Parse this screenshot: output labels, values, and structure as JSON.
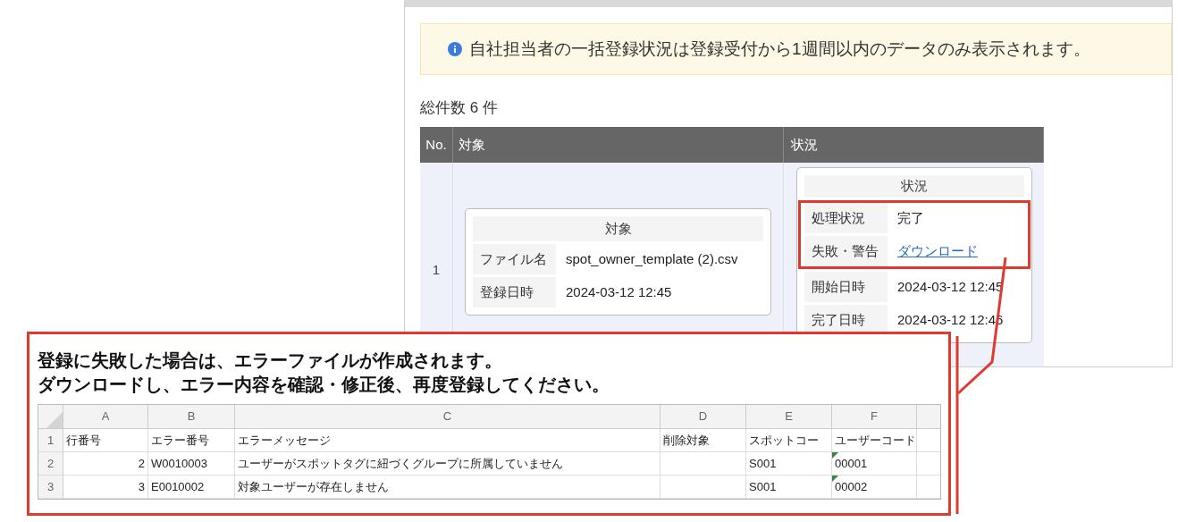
{
  "notice": {
    "text": "自社担当者の一括登録状況は登録受付から1週間以内のデータのみ表示されます。"
  },
  "total_count": "総件数 6 件",
  "table": {
    "columns": [
      "No.",
      "対象",
      "状況"
    ],
    "rows": [
      {
        "no": "1",
        "target": {
          "title": "対象",
          "fields": [
            {
              "label": "ファイル名",
              "value": "spot_owner_template (2).csv",
              "kind": "text"
            },
            {
              "label": "登録日時",
              "value": "2024-03-12 12:45",
              "kind": "text"
            }
          ]
        },
        "status": {
          "title": "状況",
          "fields": [
            {
              "label": "処理状況",
              "value": "完了",
              "kind": "text",
              "highlighted": true
            },
            {
              "label": "失敗・警告",
              "value": "ダウンロード",
              "kind": "link",
              "highlighted": true
            },
            {
              "label": "開始日時",
              "value": "2024-03-12 12:45",
              "kind": "text",
              "highlighted": false
            },
            {
              "label": "完了日時",
              "value": "2024-03-12 12:46",
              "kind": "text",
              "highlighted": false
            }
          ]
        }
      }
    ]
  },
  "callout": {
    "lines": [
      "登録に失敗した場合は、エラーファイルが作成されます。",
      "ダウンロードし、エラー内容を確認・修正後、再度登録してください。"
    ]
  },
  "spreadsheet": {
    "column_letters": [
      "A",
      "B",
      "C",
      "D",
      "E",
      "F"
    ],
    "rows": [
      {
        "number": "1",
        "cells": [
          "行番号",
          "エラー番号",
          "エラーメッセージ",
          "削除対象",
          "スポットコー",
          "ユーザーコード"
        ],
        "marked": false
      },
      {
        "number": "2",
        "cells": [
          "2",
          "W0010003",
          "ユーザーがスポットタグに紐づくグループに所属していません",
          "",
          "S001",
          "00001"
        ],
        "marked": true
      },
      {
        "number": "3",
        "cells": [
          "3",
          "E0010002",
          "対象ユーザーが存在しません",
          "",
          "S001",
          "00002"
        ],
        "marked": true
      }
    ]
  }
}
